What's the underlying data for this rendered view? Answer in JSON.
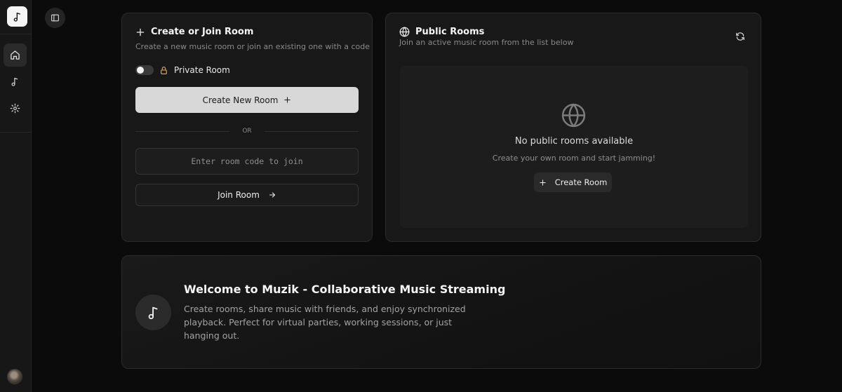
{
  "sidebar": {
    "logo_icon": "music-note-icon",
    "items": [
      {
        "name": "home",
        "icon": "home-icon",
        "active": true
      },
      {
        "name": "music",
        "icon": "music-note-icon",
        "active": false
      },
      {
        "name": "settings",
        "icon": "gear-icon",
        "active": false
      }
    ],
    "avatar": "user-avatar"
  },
  "topbar": {
    "toggle_icon": "sidebar-toggle-icon"
  },
  "create_join": {
    "title": "Create or Join Room",
    "subtitle": "Create a new music room or join an existing one with a code",
    "private_label": "Private Room",
    "private_enabled": false,
    "create_button": "Create New Room",
    "or_text": "OR",
    "room_code_placeholder": "Enter room code to join",
    "room_code_value": "",
    "join_button": "Join Room"
  },
  "public_rooms": {
    "title": "Public Rooms",
    "subtitle": "Join an active music room from the list below",
    "empty_title": "No public rooms available",
    "empty_subtitle": "Create your own room and start jamming!",
    "create_button": "Create Room"
  },
  "welcome": {
    "title": "Welcome to Muzik - Collaborative Music Streaming",
    "text": "Create rooms, share music with friends, and enjoy synchronized playback. Perfect for virtual parties, working sessions, or just hanging out."
  },
  "colors": {
    "background": "#0b0b0b",
    "card": "#181818",
    "accent_lock": "#e0a040",
    "primary_button": "#d8d8d8"
  }
}
